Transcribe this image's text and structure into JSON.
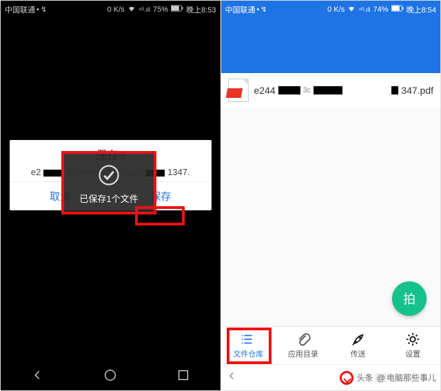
{
  "status_left": {
    "carrier": "中国联通",
    "speed": "0 K/s",
    "battery": "75%",
    "time": "晚上8:53"
  },
  "status_right": {
    "carrier": "中国联通",
    "speed": "0 K/s",
    "battery": "74%",
    "time": "晚上8:54"
  },
  "dialog": {
    "title": "保存?",
    "file_prefix": "e2",
    "file_mid": "3ffcced8c06231ad7",
    "file_suffix": "1347.",
    "cancel": "取消",
    "confirm": "保存"
  },
  "toast": {
    "text": "已保存1个文件"
  },
  "file_item": {
    "name1": "e244",
    "name2": "347.pdf"
  },
  "fab": {
    "label": "拍"
  },
  "tabs": {
    "library": "文件仓库",
    "apps": "应用目录",
    "transfer": "传送",
    "settings": "设置"
  },
  "footer": {
    "prefix": "头条",
    "at": "@",
    "author": "电脑那些事儿"
  }
}
